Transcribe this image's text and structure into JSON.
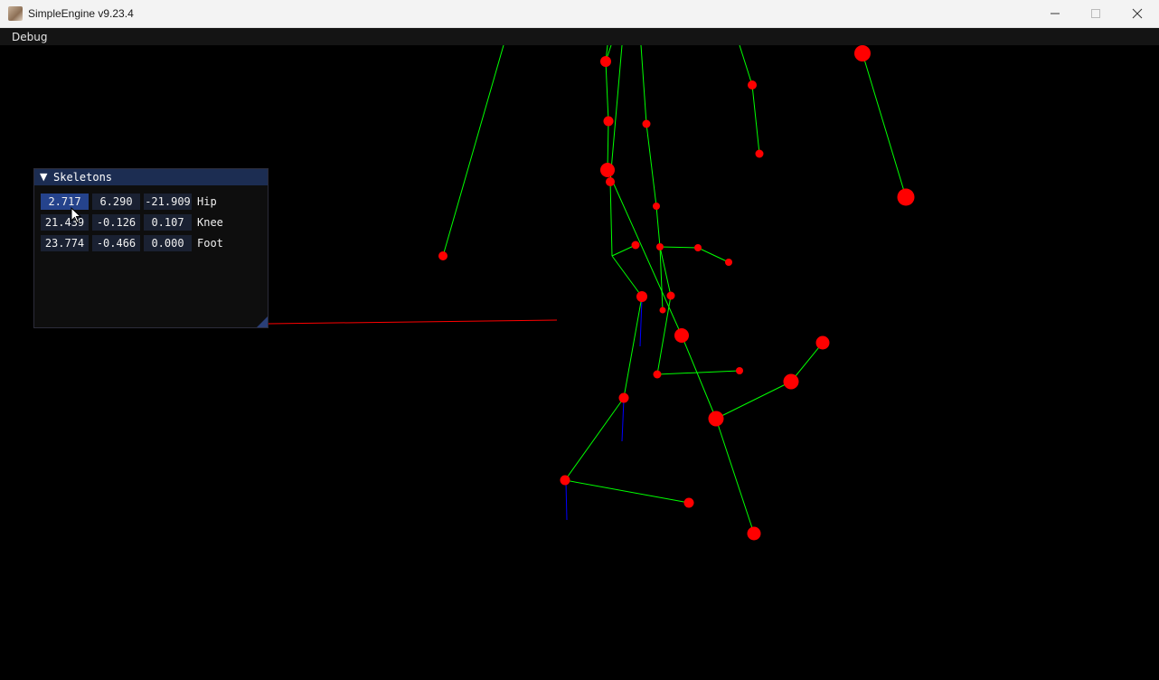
{
  "window": {
    "title": "SimpleEngine v9.23.4"
  },
  "menu": {
    "items": [
      "Debug"
    ]
  },
  "panel": {
    "title": "Skeletons",
    "rows": [
      {
        "values": [
          "2.717",
          "6.290",
          "-21.909"
        ],
        "label": "Hip"
      },
      {
        "values": [
          "21.439",
          "-0.126",
          "0.107"
        ],
        "label": "Knee"
      },
      {
        "values": [
          "23.774",
          "-0.466",
          "0.000"
        ],
        "label": "Foot"
      }
    ]
  },
  "colors": {
    "bone": "#00ff00",
    "joint": "#ff0000",
    "axis_x": "#ff0000",
    "axis_z": "#0000ff",
    "background": "#000000"
  },
  "icons": {
    "window_controls": [
      "minimize-icon",
      "maximize-icon",
      "close-icon"
    ],
    "panel_toggle": "collapse-triangle-icon"
  }
}
